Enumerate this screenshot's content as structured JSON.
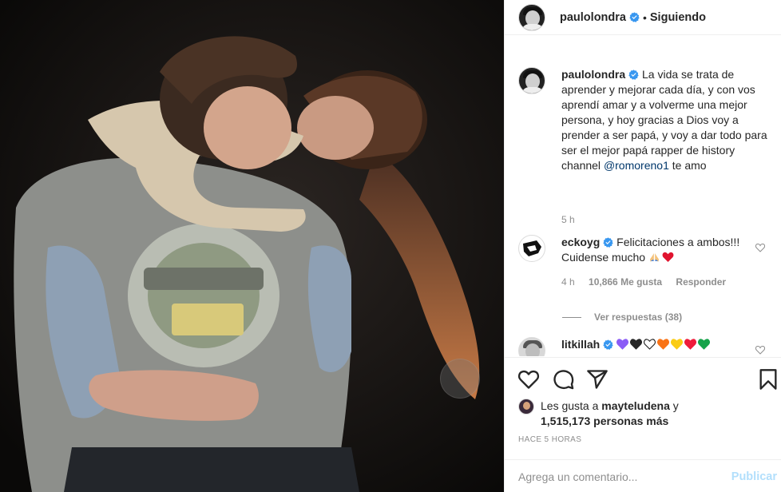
{
  "post": {
    "username": "paulolondra",
    "follow_status": "Siguiendo",
    "separator": "•"
  },
  "caption": {
    "username": "paulolondra",
    "text": "La vida se trata de aprender y mejorar cada día, y con vos aprendí amar y a volverme una mejor persona, y hoy gracias a Dios voy a prender a ser papá, y voy a dar todo para ser el mejor papá rapper de history channel",
    "mention": "@romoreno1",
    "after_mention": "te amo",
    "time": "5 h"
  },
  "comments": [
    {
      "username": "eckoyg",
      "text": "Felicitaciones a ambos!!! Cuidense mucho",
      "time": "4 h",
      "likes": "10,866 Me gusta",
      "reply": "Responder",
      "view_replies": "Ver respuestas (38)"
    },
    {
      "username": "litkillah",
      "hearts": [
        "#8b5cf6",
        "#262626",
        "#ffffff",
        "#f97316",
        "#facc15",
        "#ef1c3b",
        "#16a34a"
      ]
    }
  ],
  "likes": {
    "prefix": "Les gusta a",
    "user": "mayteludena",
    "conj": "y",
    "count": "1,515,173 personas más"
  },
  "posted_time": "HACE 5 HORAS",
  "add_comment": {
    "placeholder": "Agrega un comentario...",
    "publish": "Publicar"
  },
  "colors": {
    "verified": "#3897f0",
    "link": "#00376b",
    "muted": "#8e8e8e",
    "publish_disabled": "#b2dffc"
  },
  "icons": [
    "heart-icon",
    "comment-icon",
    "share-icon",
    "bookmark-icon",
    "verified-icon",
    "pray-emoji",
    "red-heart-emoji"
  ]
}
